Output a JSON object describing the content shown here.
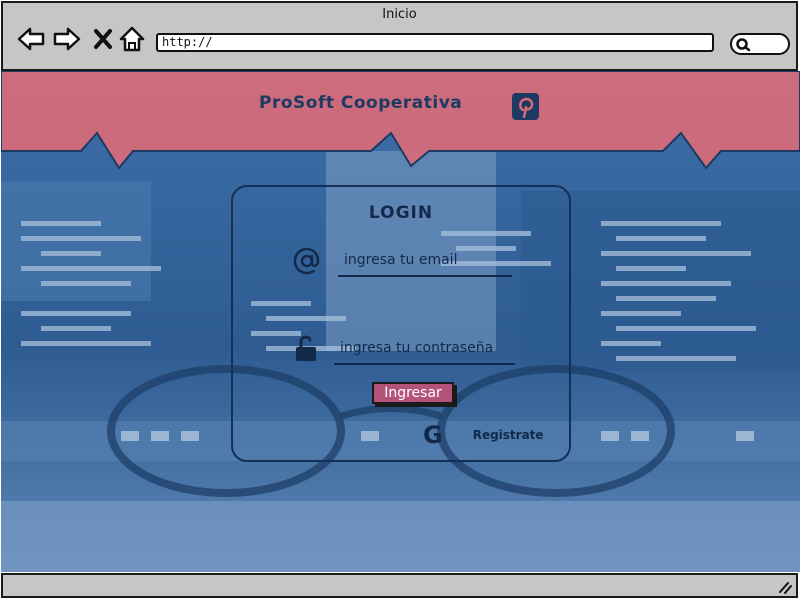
{
  "browser": {
    "title": "Inicio",
    "url": "http://",
    "nav_icons": [
      "back-arrow-icon",
      "forward-arrow-icon",
      "close-x-icon",
      "home-icon"
    ],
    "search_icon": "search-icon"
  },
  "header": {
    "brand": "ProSoft Cooperativa",
    "social_icon": "pinterest-icon"
  },
  "login": {
    "title": "LOGIN",
    "email_placeholder": "ingresa tu email",
    "email_icon": "at-sign-icon",
    "password_placeholder": "ingresa tu contraseña",
    "password_icon": "unlocked-padlock-icon",
    "submit_label": "Ingresar",
    "google_glyph": "G",
    "register_label": "Registrate"
  },
  "footer": {
    "resize_icon": "resize-grip-icon"
  },
  "colors": {
    "chrome": "#c6c6c6",
    "header_band": "#d96b78",
    "overlay_blue": "#2f5f96",
    "dark_navy": "#12294a",
    "button_pink": "#b4537a"
  }
}
